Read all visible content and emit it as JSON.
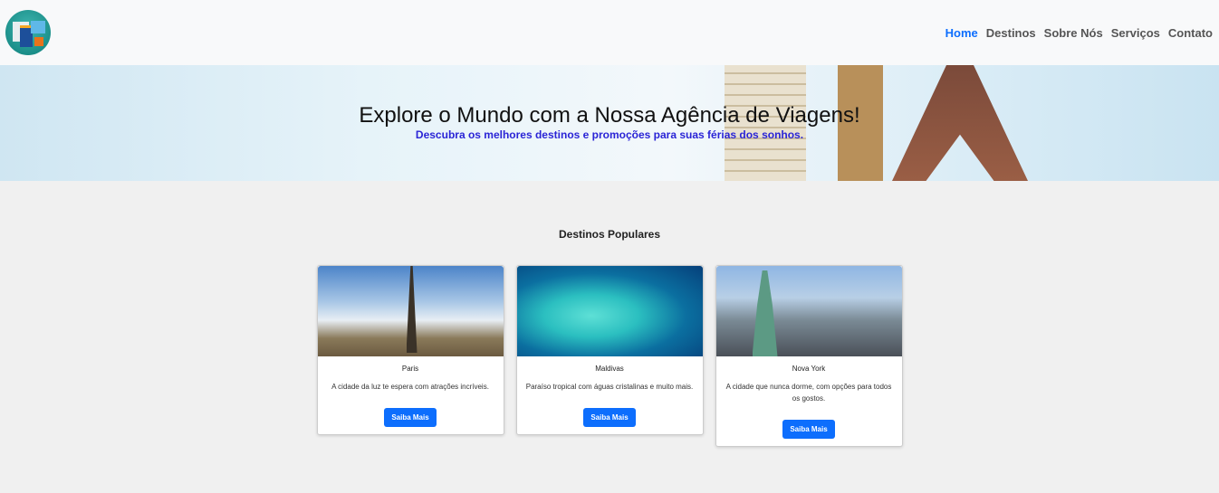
{
  "nav": {
    "items": [
      {
        "label": "Home",
        "active": true
      },
      {
        "label": "Destinos"
      },
      {
        "label": "Sobre Nós"
      },
      {
        "label": "Serviços"
      },
      {
        "label": "Contato"
      }
    ]
  },
  "hero": {
    "title": "Explore o Mundo com a Nossa Agência de Viagens!",
    "subtitle": "Descubra os melhores destinos e promoções para suas férias dos sonhos."
  },
  "section": {
    "title": "Destinos Populares"
  },
  "cards": [
    {
      "name": "Paris",
      "desc": "A cidade da luz te espera com atrações incríveis.",
      "button": "Saiba Mais"
    },
    {
      "name": "Maldivas",
      "desc": "Paraíso tropical com águas cristalinas e muito mais.",
      "button": "Saiba Mais"
    },
    {
      "name": "Nova York",
      "desc": "A cidade que nunca dorme, com opções para todos os gostos.",
      "button": "Saiba Mais"
    }
  ]
}
